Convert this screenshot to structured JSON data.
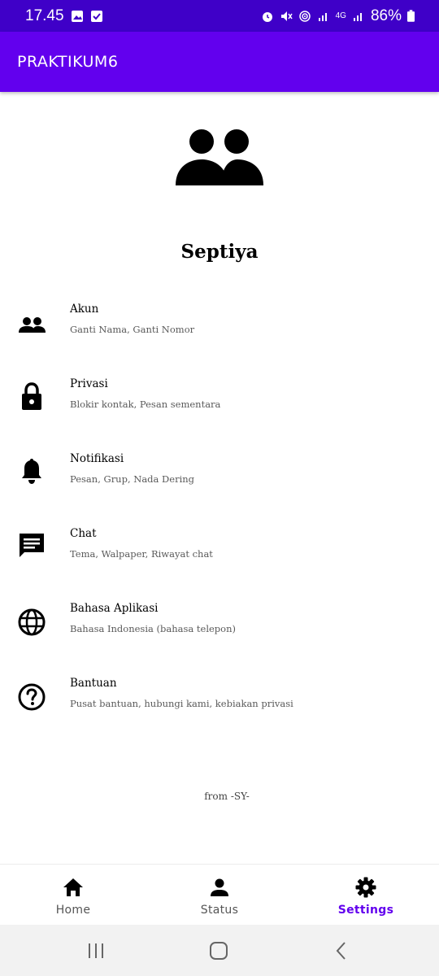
{
  "status_bar": {
    "time": "17.45",
    "battery": "86%",
    "network": "4G",
    "icons": [
      "image-icon",
      "check-icon",
      "alarm-icon",
      "mute-icon",
      "hotspot-icon",
      "signal-icon",
      "signal-icon",
      "battery-icon"
    ]
  },
  "app_bar": {
    "title": "PRAKTIKUM6",
    "color": "#6200ee"
  },
  "profile": {
    "name": "Septiya",
    "icon": "group-icon"
  },
  "menu": [
    {
      "title": "Akun",
      "subtitle": "Ganti Nama, Ganti Nomor",
      "icon": "account-icon"
    },
    {
      "title": "Privasi",
      "subtitle": "Blokir kontak, Pesan sementara",
      "icon": "lock-icon"
    },
    {
      "title": "Notifikasi",
      "subtitle": "Pesan, Grup, Nada Dering",
      "icon": "bell-icon"
    },
    {
      "title": "Chat",
      "subtitle": "Tema, Walpaper, Riwayat chat",
      "icon": "chat-icon"
    },
    {
      "title": "Bahasa Aplikasi",
      "subtitle": "Bahasa Indonesia (bahasa telepon)",
      "icon": "globe-icon"
    },
    {
      "title": "Bantuan",
      "subtitle": "Pusat bantuan, hubungi kami, kebiakan privasi",
      "icon": "help-icon"
    }
  ],
  "footer": {
    "text": "from -SY-"
  },
  "bottom_nav": {
    "items": [
      {
        "label": "Home",
        "icon": "home-icon",
        "active": false
      },
      {
        "label": "Status",
        "icon": "person-icon",
        "active": false
      },
      {
        "label": "Settings",
        "icon": "settings-icon",
        "active": true
      }
    ],
    "active_color": "#6200ee"
  },
  "system_nav": {
    "buttons": [
      "recents-button",
      "home-button",
      "back-button"
    ]
  }
}
